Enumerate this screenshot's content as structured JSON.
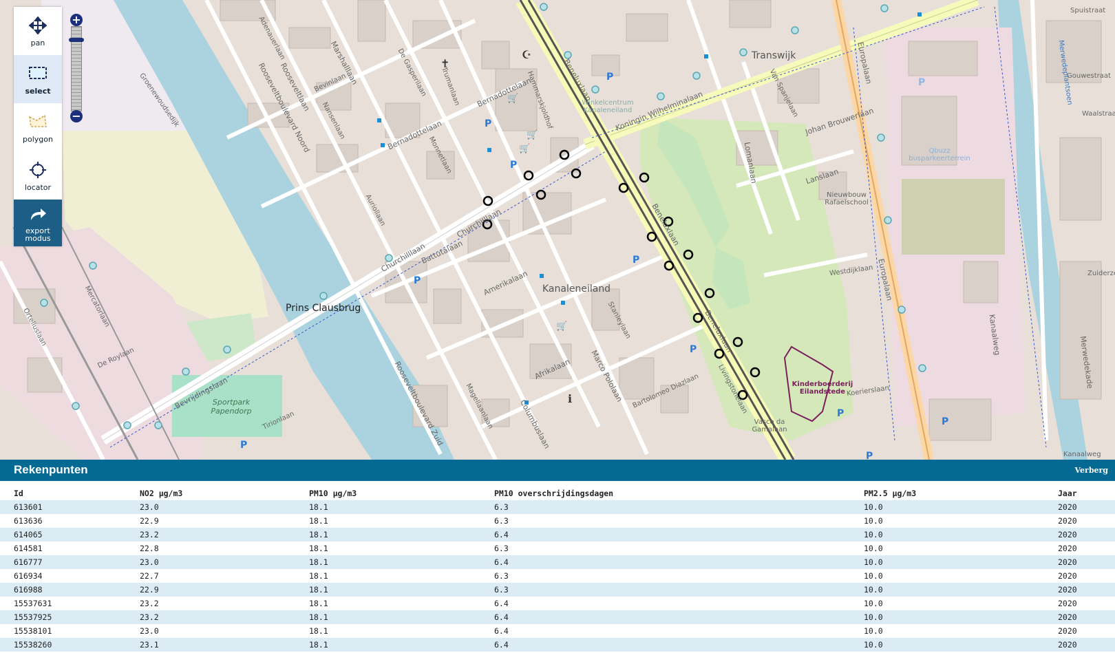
{
  "toolbar": {
    "pan": "pan",
    "select": "select",
    "polygon": "polygon",
    "locator": "locator",
    "export": "export modus"
  },
  "map": {
    "labels": {
      "transwijk": "Transwijk",
      "kanaleneiland": "Kanaleneiland",
      "prins_clausbrug": "Prins Clausbrug",
      "winkelcentrum": "Winkelcentrum Kanaleneiland",
      "kinderboerderij": "Kinderboerderij Eilandstede",
      "sportpark": "Sportpark Papendorp",
      "qbuzz": "Qbuzz busparkeerterrein",
      "nieuwbouw": "Nieuwbouw Rafaelschool",
      "vasco": "Vasco da Gamalaan",
      "europalaan": "Europalaan",
      "beneluxlaan": "Beneluxlaan",
      "churchilllaan": "Churchilllaan",
      "koningin": "Koningin Wilhelminalaan",
      "amerikalaan": "Amerikalaan",
      "afrikalaan": "Afrikalaan",
      "rooseveltlaan": "Rooseveltlaan",
      "roosevelt_noord": "Rooseveltboulevard Noord",
      "roosevelt_zuid": "Rooseveltboulevard Zuid",
      "bernadottelaan": "Bernadottelaan",
      "marshalllaan": "Marshalllaan",
      "beyrijdingslaan": "Bevrijdingslaan",
      "columbuslaan": "Columbuslaan",
      "marco_pololaan": "Marco Pololaan",
      "kanaalweg": "Kanaalweg",
      "merwedekade": "Merwedekade",
      "lomanlaan": "Lomanlaan",
      "lanslaan": "Lanslaan",
      "batutalaan": "Battutalaan",
      "nijmeegse": "Westdijklaan",
      "koerierslaan": "Koerierslaan",
      "merwedeplantsoen": "Merwedeplantsoen",
      "stanleylaan": "Stanleylaan",
      "magellaanlaan": "Magellaanlaan",
      "delarayslaan": "De Roylaan",
      "oortelius": "Orteliuslaan",
      "mercatorlaan": "Mercatorlaan",
      "tirionlaan": "Tirionlaan",
      "groenewoud": "Groenewoudsedijk",
      "livingstonelaan": "Livingstonelaan",
      "bartolomeo": "Bartolomeo Diazlaan",
      "hammarskjoldhof": "Hammarskjoldhof",
      "trumanlaan": "Trumanlaan",
      "de_gasperilaan": "De Gasperilaan",
      "monnetlaan": "Monnetlaan",
      "aurollaan": "Auriollaan",
      "bevinlaan": "Bevinlaan",
      "nansenlaan": "Nansenlaan",
      "adenauerlaan": "Adenauerlaan",
      "johan_brouwerlaan": "Johan Brouwerlaan",
      "van_spanjelaan": "Van Spanjelaan",
      "spuistraat": "Spuistraat",
      "gouwestraat": "Gouwestraat",
      "waalstraat": "Waalstraat",
      "zuiderzee": "Zuiderzee",
      "papendorp": "Papendorp"
    }
  },
  "panel": {
    "title": "Rekenpunten",
    "hide": "Verberg",
    "columns": [
      "Id",
      "NO2 µg/m3",
      "PM10 µg/m3",
      "PM10 overschrijdingsdagen",
      "PM2.5 µg/m3",
      "Jaar"
    ],
    "rows": [
      [
        "613601",
        "23.0",
        "18.1",
        "6.3",
        "10.0",
        "2020"
      ],
      [
        "613636",
        "22.9",
        "18.1",
        "6.3",
        "10.0",
        "2020"
      ],
      [
        "614065",
        "23.2",
        "18.1",
        "6.4",
        "10.0",
        "2020"
      ],
      [
        "614581",
        "22.8",
        "18.1",
        "6.3",
        "10.0",
        "2020"
      ],
      [
        "616777",
        "23.0",
        "18.1",
        "6.4",
        "10.0",
        "2020"
      ],
      [
        "616934",
        "22.7",
        "18.1",
        "6.3",
        "10.0",
        "2020"
      ],
      [
        "616988",
        "22.9",
        "18.1",
        "6.3",
        "10.0",
        "2020"
      ],
      [
        "15537631",
        "23.2",
        "18.1",
        "6.4",
        "10.0",
        "2020"
      ],
      [
        "15537925",
        "23.2",
        "18.1",
        "6.4",
        "10.0",
        "2020"
      ],
      [
        "15538101",
        "23.0",
        "18.1",
        "6.4",
        "10.0",
        "2020"
      ],
      [
        "15538260",
        "23.1",
        "18.1",
        "6.4",
        "10.0",
        "2020"
      ]
    ]
  }
}
